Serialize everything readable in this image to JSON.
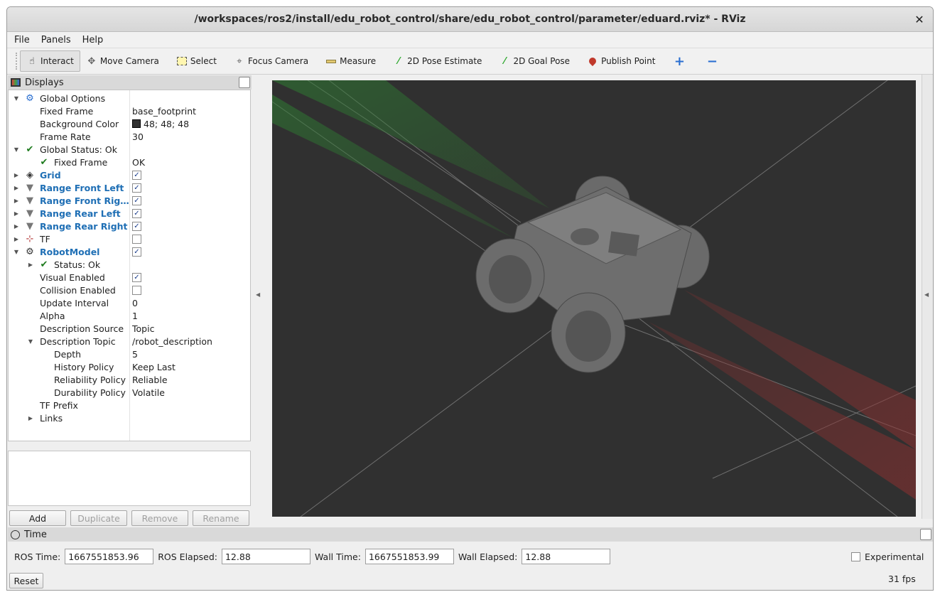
{
  "window": {
    "title": "/workspaces/ros2/install/edu_robot_control/share/edu_robot_control/parameter/eduard.rviz* - RViz",
    "close": "✕"
  },
  "menu": [
    "File",
    "Panels",
    "Help"
  ],
  "toolbar": {
    "interact": "Interact",
    "move_camera": "Move Camera",
    "select": "Select",
    "focus_camera": "Focus Camera",
    "measure": "Measure",
    "pose_estimate": "2D Pose Estimate",
    "goal_pose": "2D Goal Pose",
    "publish_point": "Publish Point"
  },
  "displays": {
    "title": "Displays",
    "rows": [
      {
        "label": "Global Options"
      },
      {
        "label": "Fixed Frame",
        "value": "base_footprint"
      },
      {
        "label": "Background Color",
        "value": "48; 48; 48"
      },
      {
        "label": "Frame Rate",
        "value": "30"
      },
      {
        "label": "Global Status: Ok"
      },
      {
        "label": "Fixed Frame",
        "value": "OK"
      },
      {
        "label": "Grid",
        "checked": true
      },
      {
        "label": "Range Front Left",
        "checked": true
      },
      {
        "label": "Range Front Rig…",
        "checked": true
      },
      {
        "label": "Range Rear Left",
        "checked": true
      },
      {
        "label": "Range Rear Right",
        "checked": true
      },
      {
        "label": "TF",
        "checked": false
      },
      {
        "label": "RobotModel",
        "checked": true
      },
      {
        "label": "Status: Ok"
      },
      {
        "label": "Visual Enabled",
        "checked": true
      },
      {
        "label": "Collision Enabled",
        "checked": false
      },
      {
        "label": "Update Interval",
        "value": "0"
      },
      {
        "label": "Alpha",
        "value": "1"
      },
      {
        "label": "Description Source",
        "value": "Topic"
      },
      {
        "label": "Description Topic",
        "value": "/robot_description"
      },
      {
        "label": "Depth",
        "value": "5"
      },
      {
        "label": "History Policy",
        "value": "Keep Last"
      },
      {
        "label": "Reliability Policy",
        "value": "Reliable"
      },
      {
        "label": "Durability Policy",
        "value": "Volatile"
      },
      {
        "label": "TF Prefix"
      },
      {
        "label": "Links"
      }
    ],
    "buttons": {
      "add": "Add",
      "duplicate": "Duplicate",
      "remove": "Remove",
      "rename": "Rename"
    }
  },
  "time": {
    "title": "Time",
    "ros_time_label": "ROS Time:",
    "ros_time": "1667551853.96",
    "ros_elapsed_label": "ROS Elapsed:",
    "ros_elapsed": "12.88",
    "wall_time_label": "Wall Time:",
    "wall_time": "1667551853.99",
    "wall_elapsed_label": "Wall Elapsed:",
    "wall_elapsed": "12.88",
    "experimental": "Experimental",
    "reset": "Reset",
    "fps": "31 fps"
  },
  "render": {
    "background": "#303030",
    "grid_color": "#8a8a8a",
    "front_beam": "#2e7d32",
    "rear_beam": "#8e2f2f",
    "robot": "#7a7a7a"
  }
}
